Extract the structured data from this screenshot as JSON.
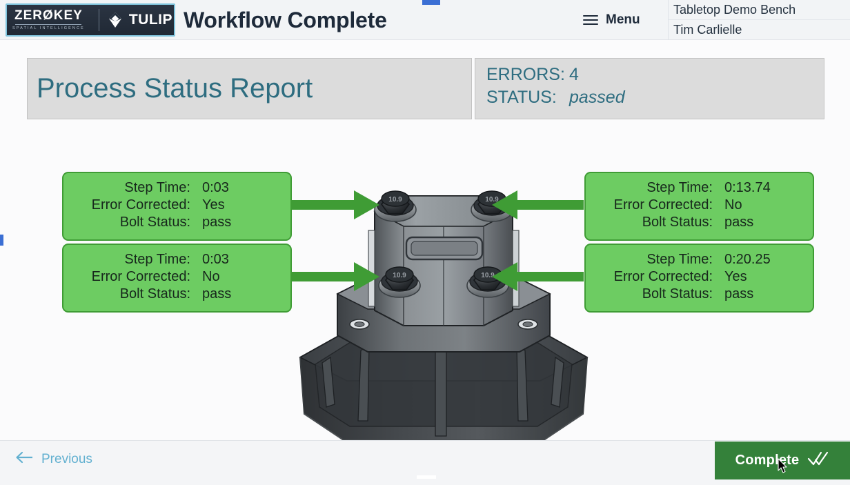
{
  "header": {
    "logo": {
      "zerokey_name": "ZERØKEY",
      "zerokey_tagline": "SPATIAL INTELLIGENCE",
      "tulip_name": "TULIP",
      "tulip_icon": "tulip-diamond-icon"
    },
    "title": "Workflow Complete",
    "menu": {
      "label": "Menu",
      "icon": "hamburger-icon"
    },
    "station": "Tabletop Demo Bench",
    "user": "Tim Carlielle"
  },
  "report": {
    "title": "Process Status Report"
  },
  "status": {
    "errors_label": "ERRORS:",
    "errors_value": "4",
    "status_label": "STATUS:",
    "status_value": "passed"
  },
  "labels": {
    "step_time": "Step Time:",
    "error_corrected": "Error Corrected:",
    "bolt_status": "Bolt Status:"
  },
  "cards": [
    {
      "position": "top-left",
      "step_time": "0:03",
      "error_corrected": "Yes",
      "bolt_status": "pass"
    },
    {
      "position": "bottom-left",
      "step_time": "0:03",
      "error_corrected": "No",
      "bolt_status": "pass"
    },
    {
      "position": "top-right",
      "step_time": "0:13.74",
      "error_corrected": "No",
      "bolt_status": "pass"
    },
    {
      "position": "bottom-right",
      "step_time": "0:20.25",
      "error_corrected": "Yes",
      "bolt_status": "pass"
    }
  ],
  "model": {
    "bolt_marking": "10.9",
    "bolt_count": 4
  },
  "footer": {
    "previous_label": "Previous",
    "previous_icon": "arrow-left-icon",
    "complete_label": "Complete",
    "complete_icon": "double-check-icon"
  },
  "colors": {
    "card_green": "#6dcc62",
    "card_border_green": "#3f9c35",
    "arrow_green": "#3f9c35",
    "complete_green": "#34813a",
    "report_teal": "#2e6d80",
    "panel_gray": "#dcdcdc",
    "previous_blue": "#62b0d0",
    "header_bg": "#f2f4f6"
  }
}
